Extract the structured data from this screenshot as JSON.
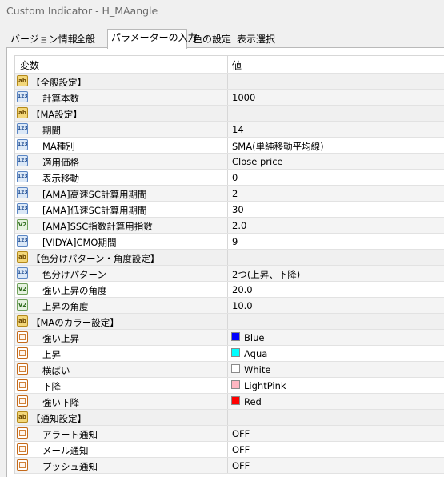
{
  "window": {
    "title": "Custom Indicator - H_MAangle"
  },
  "tabs": [
    {
      "label": "バージョン情報"
    },
    {
      "label": "全般"
    },
    {
      "label": "パラメーターの入力"
    },
    {
      "label": "色の設定"
    },
    {
      "label": "表示選択"
    }
  ],
  "table": {
    "headers": {
      "variable": "変数",
      "value": "値"
    },
    "rows": [
      {
        "type": "group",
        "icon": "ab-icon",
        "label": "【全般設定】",
        "value": ""
      },
      {
        "type": "param",
        "icon": "int-icon",
        "label": "計算本数",
        "value": "1000"
      },
      {
        "type": "group",
        "icon": "ab-icon",
        "label": "【MA設定】",
        "value": ""
      },
      {
        "type": "param",
        "icon": "int-icon",
        "label": "期間",
        "value": "14"
      },
      {
        "type": "param",
        "icon": "int-icon",
        "label": "MA種別",
        "value": "SMA(単純移動平均線)"
      },
      {
        "type": "param",
        "icon": "int-icon",
        "label": "適用価格",
        "value": "Close price"
      },
      {
        "type": "param",
        "icon": "int-icon",
        "label": "表示移動",
        "value": "0"
      },
      {
        "type": "param",
        "icon": "int-icon",
        "label": "[AMA]高速SC計算用期間",
        "value": "2"
      },
      {
        "type": "param",
        "icon": "int-icon",
        "label": "[AMA]低速SC計算用期間",
        "value": "30"
      },
      {
        "type": "param",
        "icon": "double-icon",
        "label": "[AMA]SSC指数計算用指数",
        "value": "2.0"
      },
      {
        "type": "param",
        "icon": "int-icon",
        "label": "[VIDYA]CMO期間",
        "value": "9"
      },
      {
        "type": "group",
        "icon": "ab-icon",
        "label": "【色分けパターン・角度設定】",
        "value": ""
      },
      {
        "type": "param",
        "icon": "int-icon",
        "label": "色分けパターン",
        "value": "2つ(上昇、下降)"
      },
      {
        "type": "param",
        "icon": "double-icon",
        "label": "強い上昇の角度",
        "value": "20.0"
      },
      {
        "type": "param",
        "icon": "double-icon",
        "label": "上昇の角度",
        "value": "10.0"
      },
      {
        "type": "group",
        "icon": "ab-icon",
        "label": "【MAのカラー設定】",
        "value": ""
      },
      {
        "type": "color",
        "icon": "color-icon",
        "label": "強い上昇",
        "value": "Blue",
        "color": "#0000ff"
      },
      {
        "type": "color",
        "icon": "color-icon",
        "label": "上昇",
        "value": "Aqua",
        "color": "#00ffff"
      },
      {
        "type": "color",
        "icon": "color-icon",
        "label": "横ばい",
        "value": "White",
        "color": "#ffffff"
      },
      {
        "type": "color",
        "icon": "color-icon",
        "label": "下降",
        "value": "LightPink",
        "color": "#ffb6c1"
      },
      {
        "type": "color",
        "icon": "color-icon",
        "label": "強い下降",
        "value": "Red",
        "color": "#ff0000"
      },
      {
        "type": "group",
        "icon": "ab-icon",
        "label": "【通知設定】",
        "value": ""
      },
      {
        "type": "param",
        "icon": "color-icon",
        "label": "アラート通知",
        "value": "OFF"
      },
      {
        "type": "param",
        "icon": "color-icon",
        "label": "メール通知",
        "value": "OFF"
      },
      {
        "type": "param",
        "icon": "color-icon",
        "label": "プッシュ通知",
        "value": "OFF"
      }
    ]
  }
}
